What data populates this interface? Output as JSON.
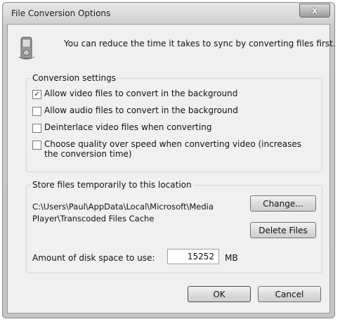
{
  "dialog": {
    "title": "File Conversion Options",
    "close_label": "x",
    "info_text": "You can reduce the time it takes to sync by converting files first."
  },
  "conversion": {
    "group_label": "Conversion settings",
    "options": [
      {
        "label": "Allow video files to convert in the background",
        "checked": true,
        "check_mark": "✓"
      },
      {
        "label": "Allow audio files to convert in the background",
        "checked": false,
        "check_mark": ""
      },
      {
        "label": "Deinterlace video files when converting",
        "checked": false,
        "check_mark": ""
      },
      {
        "label": "Choose quality over speed when converting video (increases the conversion time)",
        "checked": false,
        "check_mark": ""
      }
    ]
  },
  "storage": {
    "group_label": "Store files temporarily to this location",
    "path": "C:\\Users\\Paul\\AppData\\Local\\Microsoft\\Media Player\\Transcoded Files Cache",
    "change_label": "Change...",
    "delete_label": "Delete Files",
    "disk_label": "Amount of disk space to use:",
    "disk_value": "15252",
    "disk_unit": "MB"
  },
  "footer": {
    "ok_label": "OK",
    "cancel_label": "Cancel"
  },
  "icons": {
    "info_icon": "portable-device-icon",
    "close_icon": "close-icon"
  }
}
